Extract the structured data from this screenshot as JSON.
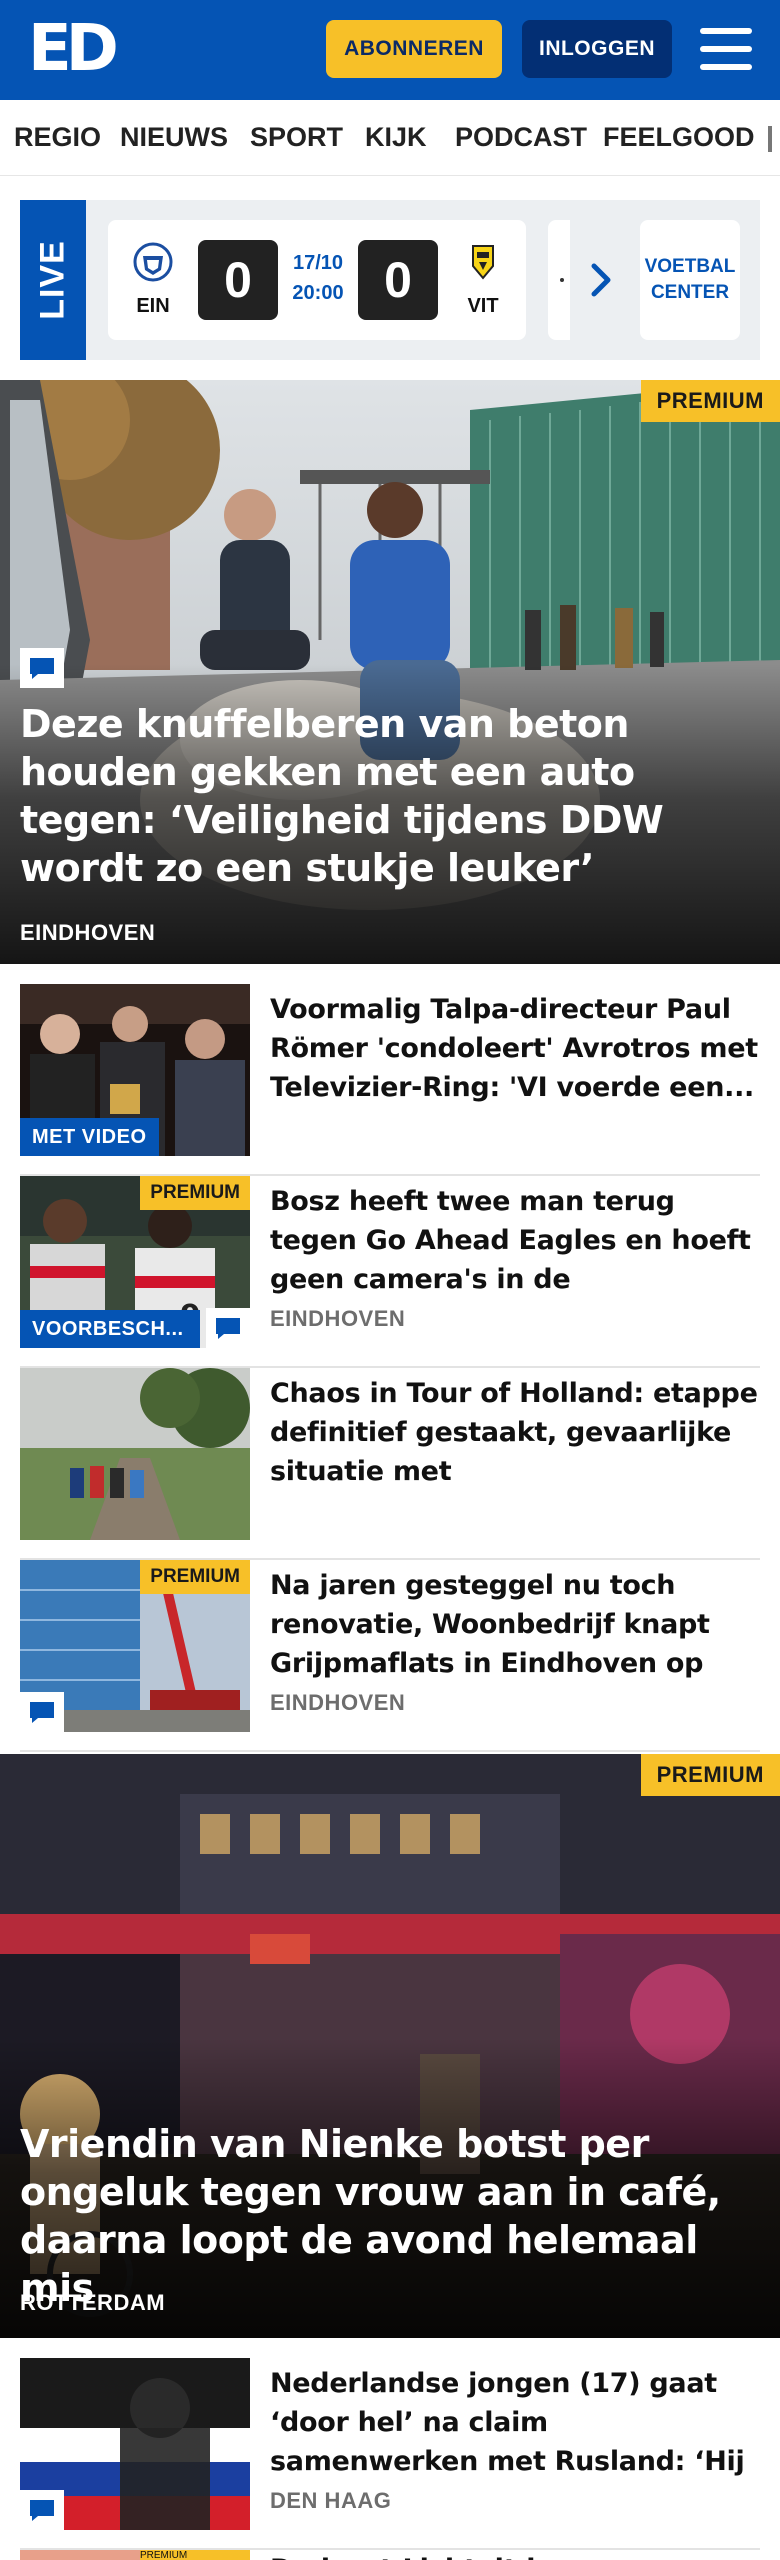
{
  "header": {
    "logo": "ED",
    "subscribe_label": "ABONNEREN",
    "login_label": "INLOGGEN",
    "menu_icon": "hamburger-menu-icon",
    "brand_color": "#0554b4",
    "accent_color": "#f7c028"
  },
  "nav": {
    "items": [
      "REGIO",
      "NIEUWS",
      "SPORT",
      "KIJK",
      "PODCAST",
      "FEELGOOD"
    ]
  },
  "live": {
    "tab_label": "LIVE",
    "match": {
      "home_team": "EIN",
      "away_team": "VIT",
      "home_score": "0",
      "away_score": "0",
      "date": "17/10",
      "time": "20:00"
    },
    "next_icon": "chevron-right-icon",
    "center_label_line1": "VOETBAL",
    "center_label_line2": "CENTER"
  },
  "hero1": {
    "premium": "PREMIUM",
    "title": "Deze knuffelberen van beton houden gekken met een auto tegen: ‘Veiligheid tijdens DDW wordt zo een stukje leuker’",
    "location": "EINDHOVEN"
  },
  "articles": [
    {
      "title": "Voormalig Talpa-directeur Paul Römer 'condoleert' Avrotros met Televizier-Ring: 'VI voerde een...",
      "label": "MET VIDEO",
      "premium": "",
      "location": ""
    },
    {
      "title": "Bosz heeft twee man terug tegen Go Ahead Eagles en hoeft geen camera's in de kleedkamer: ‘Da...",
      "label": "VOORBESCH...",
      "premium": "PREMIUM",
      "location": "EINDHOVEN"
    },
    {
      "title": "Chaos in Tour of Holland: etappe definitief gestaakt, gevaarlijke situatie met tegemoetkomende...",
      "label": "",
      "premium": "",
      "location": ""
    },
    {
      "title": "Na jaren gesteggel nu toch renovatie, Woonbedrijf knapt Grijpmaflats in Eindhoven op en...",
      "label": "",
      "premium": "PREMIUM",
      "location": "EINDHOVEN"
    }
  ],
  "hero2": {
    "premium": "PREMIUM",
    "title": "Vriendin van Nienke botst per ongeluk tegen vrouw aan in café, daarna loopt de avond helemaal mis",
    "location": "ROTTERDAM"
  },
  "article_last": {
    "title": "Nederlandse jongen (17) gaat ‘door hel’ na claim samenwerken met Rusland: ‘Hij kwam nooit...",
    "location": "DEN HAAG"
  },
  "article_partial": {
    "premium": "PREMIUM",
    "title": "Dedroat Lichtvit he..."
  }
}
